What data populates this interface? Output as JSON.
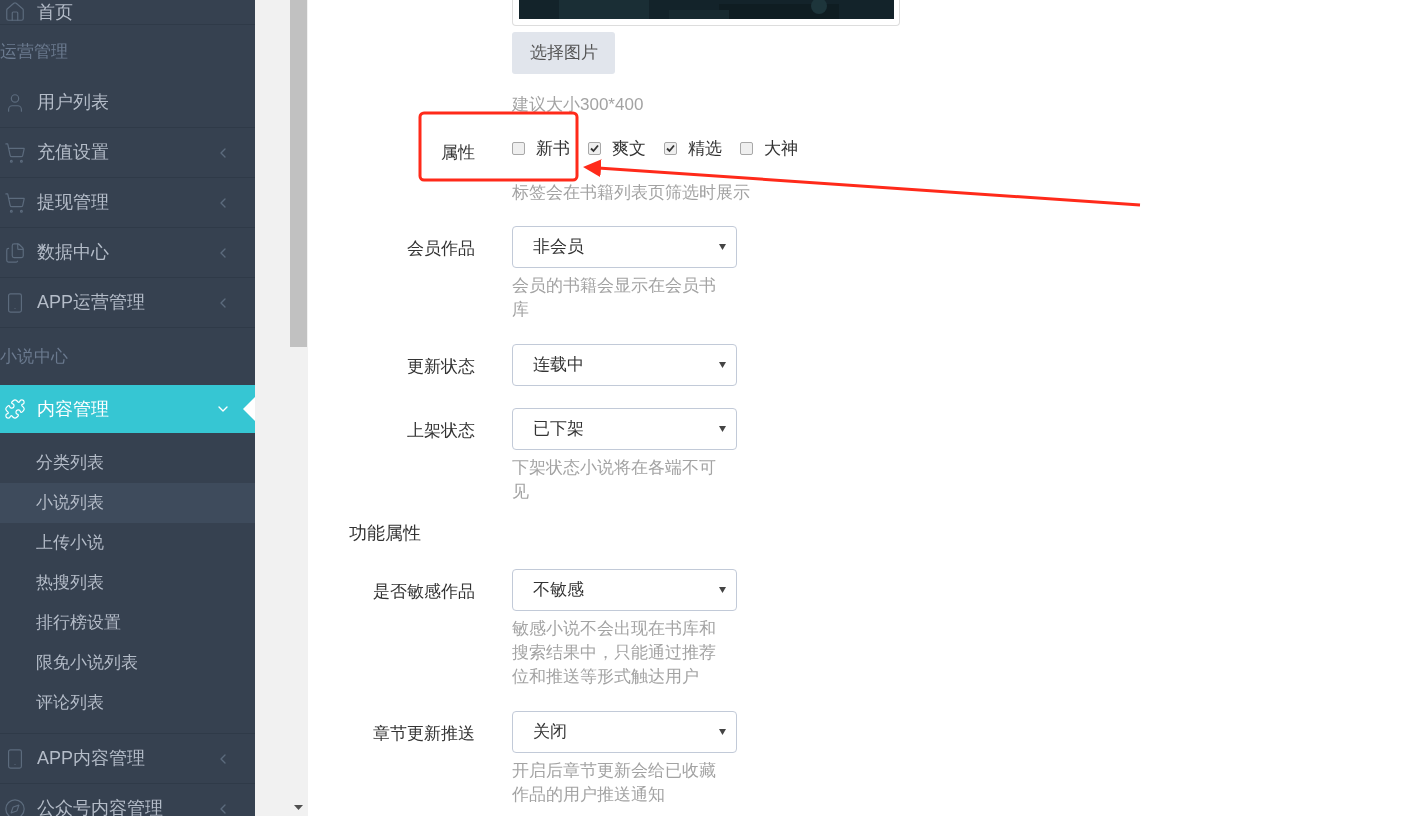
{
  "sidebar": {
    "items": [
      {
        "kind": "item",
        "label": "首页"
      },
      {
        "kind": "header",
        "label": "运营管理"
      },
      {
        "kind": "item",
        "label": "用户列表"
      },
      {
        "kind": "item",
        "label": "充值设置",
        "expanded": false
      },
      {
        "kind": "item",
        "label": "提现管理",
        "expanded": false
      },
      {
        "kind": "item",
        "label": "数据中心",
        "expanded": false
      },
      {
        "kind": "item",
        "label": "APP运营管理",
        "expanded": false
      },
      {
        "kind": "header",
        "label": "小说中心"
      },
      {
        "kind": "item",
        "label": "内容管理",
        "expanded": true,
        "selected": true,
        "children": [
          {
            "label": "分类列表",
            "selected": false
          },
          {
            "label": "小说列表",
            "selected": true
          },
          {
            "label": "上传小说",
            "selected": false
          },
          {
            "label": "热搜列表",
            "selected": false
          },
          {
            "label": "排行榜设置",
            "selected": false
          },
          {
            "label": "限免小说列表",
            "selected": false
          },
          {
            "label": "评论列表",
            "selected": false
          }
        ]
      },
      {
        "kind": "item",
        "label": "APP内容管理",
        "expanded": false
      },
      {
        "kind": "item",
        "label": "公众号内容管理",
        "expanded": false
      }
    ]
  },
  "form": {
    "fields": [
      {
        "button": "选择图片",
        "hint": "建议大小300*400"
      },
      {
        "kind": "checkboxes",
        "label": "属性",
        "options": [
          {
            "label": "新书",
            "checked": false
          },
          {
            "label": "爽文",
            "checked": true
          },
          {
            "label": "精选",
            "checked": true
          },
          {
            "label": "大神",
            "checked": false
          }
        ],
        "hint": "标签会在书籍列表页筛选时展示"
      },
      {
        "kind": "select",
        "label": "会员作品",
        "value": "非会员",
        "hint": "会员的书籍会显示在会员书库"
      },
      {
        "kind": "select",
        "label": "更新状态",
        "value": "连载中"
      },
      {
        "kind": "select",
        "label": "上架状态",
        "value": "已下架",
        "hint": "下架状态小说将在各端不可见"
      },
      {
        "kind": "section",
        "label": "功能属性"
      },
      {
        "kind": "select",
        "label": "是否敏感作品",
        "value": "不敏感",
        "hint": "敏感小说不会出现在书库和搜索结果中，只能通过推荐位和推送等形式触达用户"
      },
      {
        "kind": "select",
        "label": "章节更新推送",
        "value": "关闭",
        "hint": "开启后章节更新会给已收藏作品的用户推送通知"
      }
    ]
  }
}
